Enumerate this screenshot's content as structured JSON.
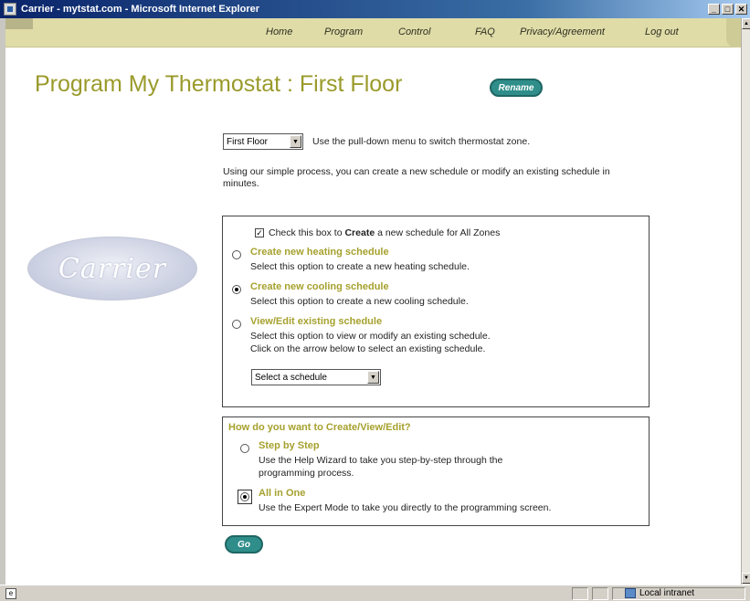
{
  "window": {
    "title": "Carrier - mytstat.com - Microsoft Internet Explorer",
    "controls": [
      "_",
      "□",
      "✕"
    ]
  },
  "nav": {
    "items": [
      "Home",
      "Program",
      "Control",
      "FAQ",
      "Privacy/Agreement",
      "Log out"
    ]
  },
  "page": {
    "title": "Program My Thermostat :  First Floor",
    "rename_label": "Rename"
  },
  "zone": {
    "selected": "First Floor",
    "hint": "Use the pull-down menu to switch thermostat zone."
  },
  "intro": "Using our simple process, you can create a new schedule or modify an existing schedule in minutes.",
  "logo": {
    "text": "Carrier"
  },
  "schedule_panel": {
    "all_zones_checkbox": {
      "checked": true,
      "prefix": "Check this box to ",
      "bold": "Create",
      "suffix": " a new schedule for All Zones"
    },
    "options": [
      {
        "title": "Create new heating schedule",
        "desc": "Select this option to create a new heating schedule.",
        "checked": false
      },
      {
        "title": "Create new cooling schedule",
        "desc": "Select this option to create a new cooling schedule.",
        "checked": true
      },
      {
        "title": "View/Edit existing schedule",
        "desc": "Select this option to view or modify an existing schedule.",
        "desc2": "Click on the arrow below to select an existing schedule.",
        "checked": false
      }
    ],
    "schedule_select": "Select a schedule"
  },
  "mode_panel": {
    "heading": "How do you want to Create/View/Edit?",
    "options": [
      {
        "title": "Step by Step",
        "desc": "Use the Help Wizard to take you step-by-step through the",
        "desc2": "programming process.",
        "checked": false
      },
      {
        "title": "All in One",
        "desc": "Use the Expert Mode to take you directly to the programming screen.",
        "checked": true
      }
    ]
  },
  "go_label": "Go",
  "status": {
    "zone": "Local intranet"
  }
}
